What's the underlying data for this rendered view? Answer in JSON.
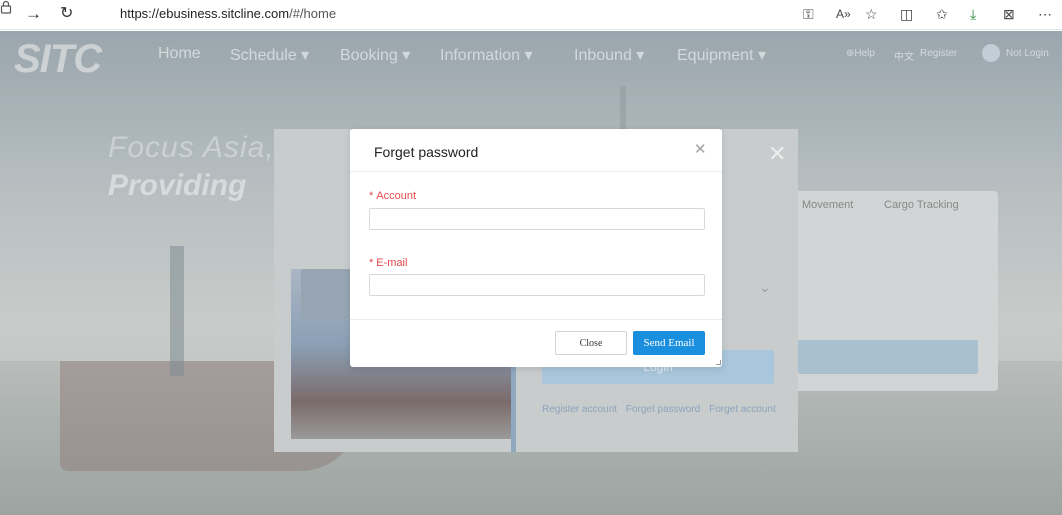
{
  "browser": {
    "url_host": "https://ebusiness.sitcline.com",
    "url_path": "/#/home"
  },
  "site": {
    "logo": "SITC",
    "nav": [
      {
        "label": "Home"
      },
      {
        "label": "Schedule ▾"
      },
      {
        "label": "Booking ▾"
      },
      {
        "label": "Information ▾"
      },
      {
        "label": "Inbound ▾"
      },
      {
        "label": "Equipment ▾"
      }
    ],
    "top_right": [
      "⊕Help",
      "中文",
      "Register",
      "Not Login"
    ],
    "hero_line1": "Focus Asia,",
    "hero_line2": "Providing"
  },
  "tracking_card": {
    "tabs": [
      "Movement",
      "Cargo Tracking"
    ]
  },
  "login_modal": {
    "login_button": "Login",
    "links": [
      "Register account",
      "Forget password",
      "Forget account"
    ]
  },
  "dialog": {
    "title": "Forget password",
    "account_label": "Account",
    "account_value": "",
    "email_label": "E-mail",
    "email_value": "",
    "required_marker": "*",
    "close_button": "Close",
    "send_button": "Send Email"
  }
}
